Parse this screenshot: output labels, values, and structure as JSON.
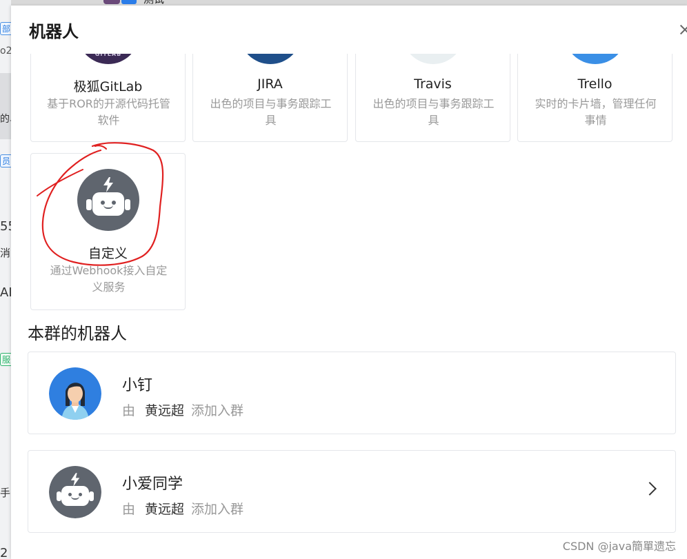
{
  "background": {
    "left_fragments": [
      "部",
      "o2",
      "的单",
      "员",
      "55",
      "消",
      "AI",
      "服务",
      "手",
      "2"
    ],
    "top_text": "测试"
  },
  "dialog": {
    "title": "机器人",
    "close_icon": "close-icon"
  },
  "integrations": [
    {
      "name": "极狐GitLab",
      "desc": "基于ROR的开源代码托管软件",
      "logo_text": "GITLAB",
      "color": "#3b2a55"
    },
    {
      "name": "JIRA",
      "desc": "出色的项目与事务跟踪工具",
      "color": "#1f4f8a"
    },
    {
      "name": "Travis",
      "desc": "出色的项目与事务跟踪工具",
      "color": "#e9eff1"
    },
    {
      "name": "Trello",
      "desc": "实时的卡片墙，管理任何事情",
      "color": "#3a8fe6"
    },
    {
      "name": "自定义",
      "desc": "通过Webhook接入自定义服务",
      "icon": "robot-icon",
      "color": "#5f656e"
    }
  ],
  "section": {
    "title": "本群的机器人"
  },
  "bots": [
    {
      "name": "小钉",
      "by": "由",
      "creator": "黄远超",
      "action": "添加入群",
      "avatar": "woman-avatar-icon"
    },
    {
      "name": "小爱同学",
      "by": "由",
      "creator": "黄远超",
      "action": "添加入群",
      "avatar": "robot-icon",
      "chevron": "chevron-right-icon"
    }
  ],
  "watermark": "CSDN @java簡單遗忘",
  "colors": {
    "annotation_red": "#e02020",
    "robot_gray": "#5f656e",
    "muted_text": "#999999"
  }
}
